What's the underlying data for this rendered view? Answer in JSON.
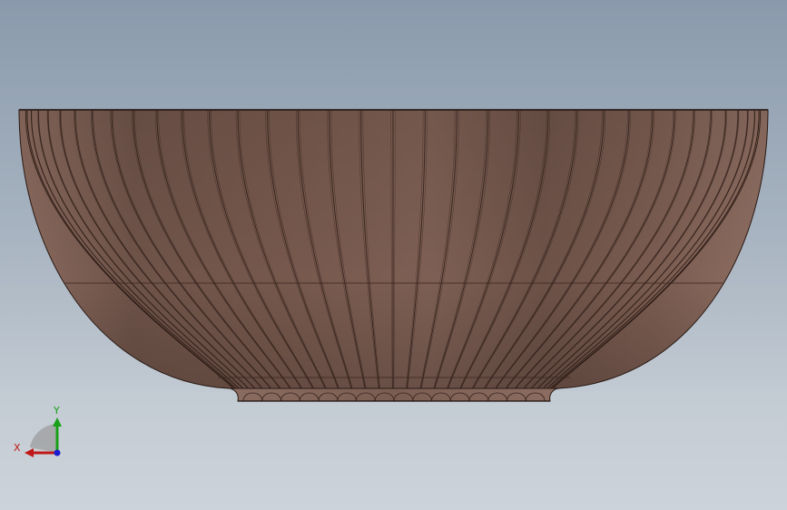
{
  "viewport": {
    "background_top": "#8a9aac",
    "background_bottom": "#cdd3da"
  },
  "model": {
    "part": "bowl",
    "view": "front",
    "body_color": "#7a5e54",
    "edge_color": "#2a1a14",
    "rib_count": 36
  },
  "triad": {
    "x_label": "X",
    "y_label": "Y",
    "x_color": "#c01818",
    "y_color": "#18a018",
    "z_color": "#1a1ad0"
  }
}
